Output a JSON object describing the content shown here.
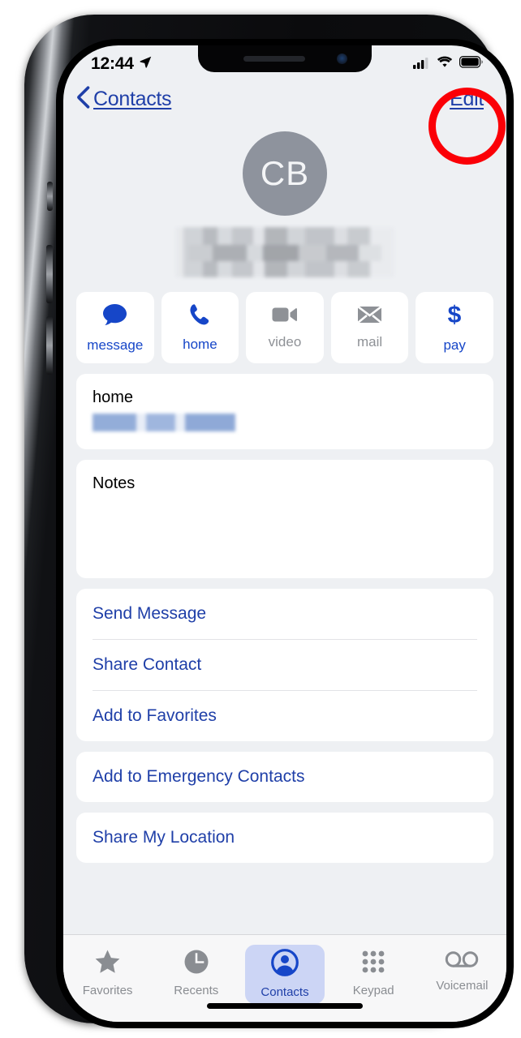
{
  "status_bar": {
    "time": "12:44",
    "location_icon": "location-arrow-icon",
    "cellular_icon": "cellular-bars-icon",
    "wifi_icon": "wifi-icon",
    "battery_icon": "battery-full-icon"
  },
  "nav_bar": {
    "back_label": "Contacts",
    "back_icon": "chevron-left-icon",
    "edit_label": "Edit"
  },
  "annotation": {
    "ring_color": "#fb0007",
    "target": "Edit"
  },
  "contact": {
    "initials": "CB",
    "name_redacted": true,
    "avatar_color": "#8e939d"
  },
  "quick_actions": [
    {
      "label": "message",
      "icon": "message-bubble-icon",
      "enabled": true
    },
    {
      "label": "home",
      "icon": "phone-handset-icon",
      "enabled": true
    },
    {
      "label": "video",
      "icon": "video-camera-icon",
      "enabled": false
    },
    {
      "label": "mail",
      "icon": "envelope-icon",
      "enabled": false
    },
    {
      "label": "pay",
      "icon": "dollar-sign-icon",
      "enabled": true
    }
  ],
  "fields": {
    "phone_label": "home",
    "phone_value_redacted": true,
    "notes_label": "Notes",
    "notes_value": ""
  },
  "actions_group_1": [
    "Send Message",
    "Share Contact",
    "Add to Favorites"
  ],
  "actions_group_2": [
    "Add to Emergency Contacts"
  ],
  "actions_group_3": [
    "Share My Location"
  ],
  "tab_bar": {
    "items": [
      {
        "label": "Favorites",
        "icon": "star-icon",
        "active": false
      },
      {
        "label": "Recents",
        "icon": "clock-icon",
        "active": false
      },
      {
        "label": "Contacts",
        "icon": "person-circle-icon",
        "active": true
      },
      {
        "label": "Keypad",
        "icon": "keypad-dots-icon",
        "active": false
      },
      {
        "label": "Voicemail",
        "icon": "voicemail-icon",
        "active": false
      }
    ]
  },
  "colors": {
    "accent_blue": "#1f3fa8",
    "action_blue": "#1646c8",
    "tab_active_bg": "#ccd5f5",
    "screen_bg": "#eef0f3",
    "card_bg": "#ffffff",
    "disabled_gray": "#8e9196"
  }
}
